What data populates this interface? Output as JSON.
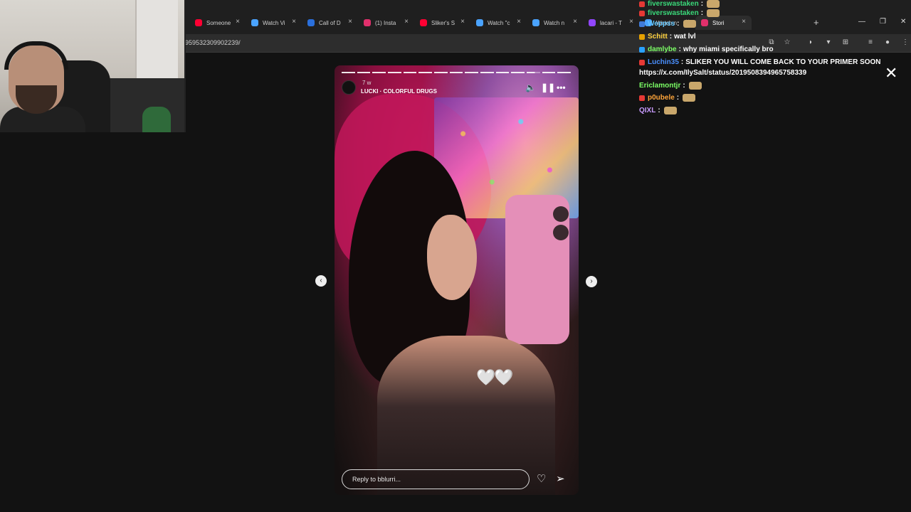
{
  "browser": {
    "tabs": [
      {
        "label": "Someone",
        "color": "#ff0033"
      },
      {
        "label": "Watch Vi",
        "color": "#4aa3ff"
      },
      {
        "label": "Call of D",
        "color": "#2a6fdb"
      },
      {
        "label": "(1) Insta",
        "color": "#e1306c"
      },
      {
        "label": "Sliker's S",
        "color": "#ff0033"
      },
      {
        "label": "Watch \"c",
        "color": "#4aa3ff"
      },
      {
        "label": "Watch n",
        "color": "#4aa3ff"
      },
      {
        "label": "lacari - T",
        "color": "#9146ff"
      },
      {
        "label": "Watch n",
        "color": "#4aa3ff"
      },
      {
        "label": "Stori",
        "color": "#e1306c",
        "active": true
      }
    ],
    "url_fragment": "959532309902239/"
  },
  "chat": {
    "messages": [
      {
        "user": "fiverswastaken",
        "color": "#3ad97a",
        "text": "",
        "emote": true,
        "badge": "#e53935"
      },
      {
        "user": "fiverswastaken",
        "color": "#3ad97a",
        "text": "",
        "emote": true,
        "badge": "#e53935"
      },
      {
        "user": "Weppss",
        "color": "#62c7ff",
        "text": "",
        "emote": true,
        "badge": "#3f7bd8"
      },
      {
        "user": "Schitt",
        "color": "#ffd23f",
        "text": "wat lvl",
        "emote": false,
        "badge": "#e5a100"
      },
      {
        "user": "damlybe",
        "color": "#7cff66",
        "text": "why miami specifically bro",
        "emote": false,
        "badge": "#2aa1ff"
      },
      {
        "user": "Luchin35",
        "color": "#4a90ff",
        "text": "SLIKER YOU WILL COME BACK TO YOUR PRIMER SOON",
        "emote": false,
        "badge": "#e53935"
      },
      {
        "user": "",
        "color": "#ffffff",
        "text": "https://x.com/IlySalt/status/2019508394965758339",
        "emote": false,
        "badge": ""
      },
      {
        "user": "Ericlamontjr",
        "color": "#7cff66",
        "text": "",
        "emote": true,
        "badge": ""
      },
      {
        "user": "p0ubele",
        "color": "#ffa53a",
        "text": "",
        "emote": true,
        "badge": "#e53935"
      },
      {
        "user": "QIXL",
        "color": "#c89bff",
        "text": "",
        "emote": true,
        "badge": ""
      }
    ]
  },
  "story": {
    "time": "7 w",
    "music": "LUCKI · COLORFUL DRUGS",
    "reply_placeholder": "Reply to bblurri...",
    "progress_segments": 15,
    "hearts": "🤍🤍",
    "icons": [
      "speaker-icon",
      "pause-icon",
      "more-icon",
      "heart-icon",
      "send-icon",
      "prev-icon",
      "next-icon",
      "close-icon"
    ]
  }
}
